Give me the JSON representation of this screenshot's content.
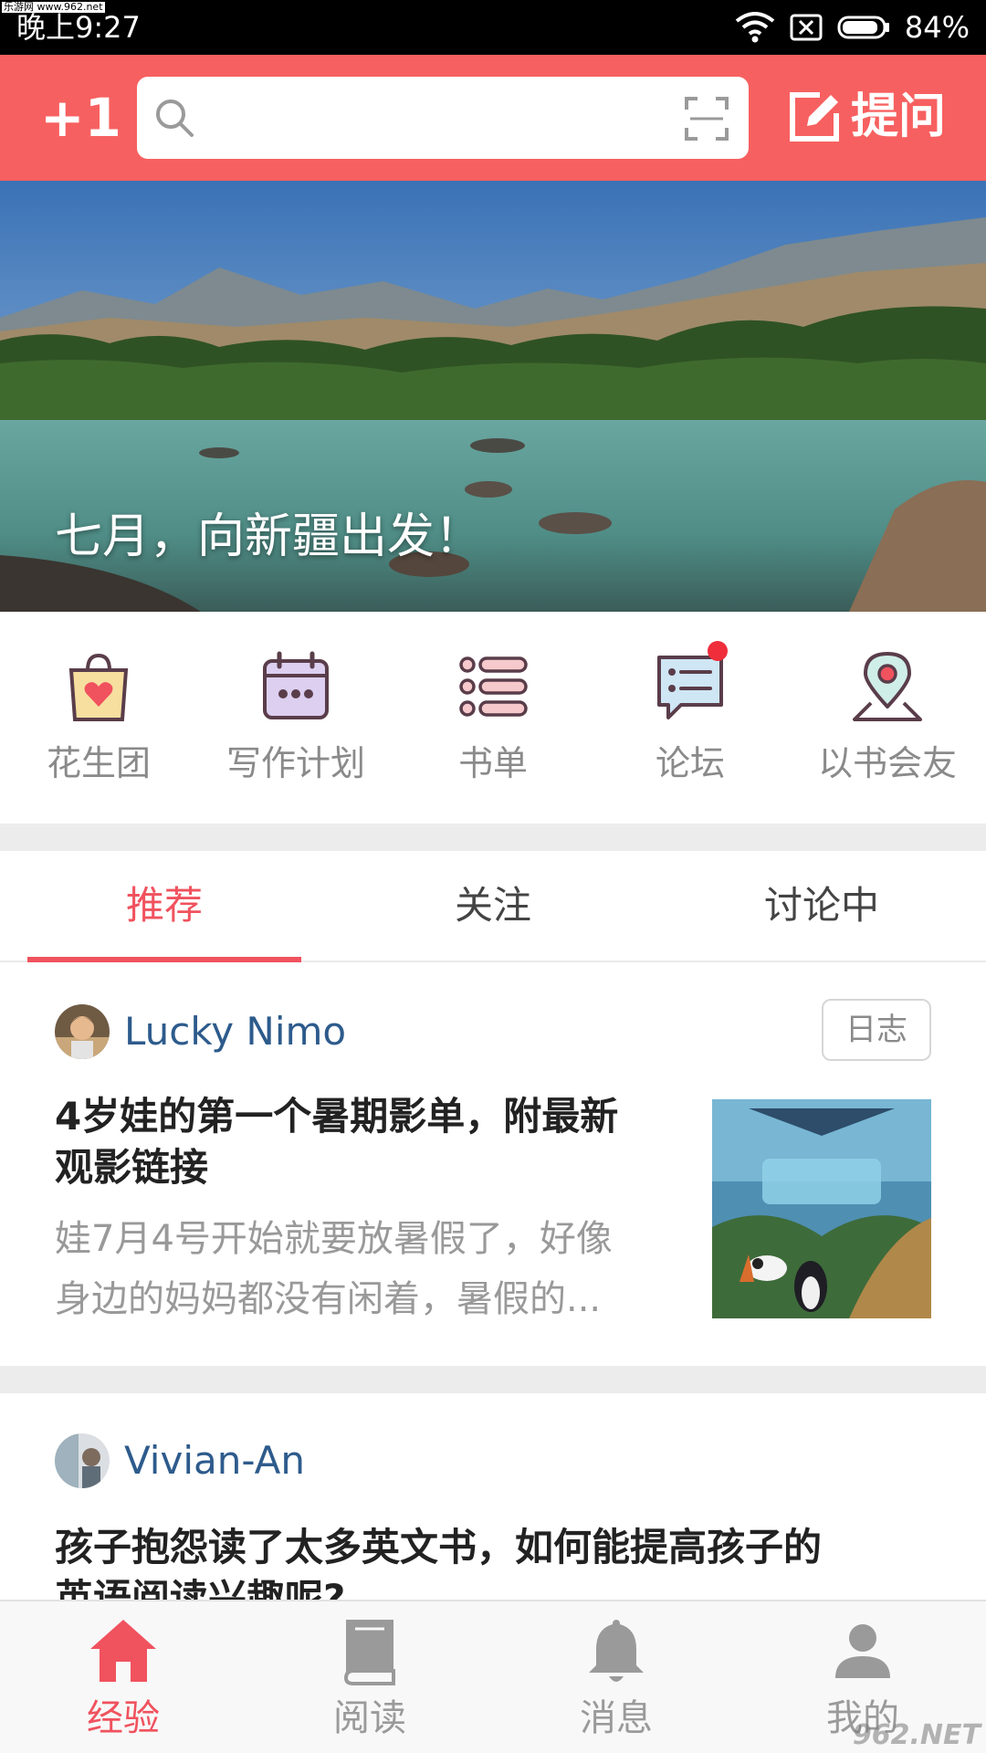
{
  "status_bar": {
    "watermark": "乐游网 www.962.net",
    "time": "晚上9:27",
    "battery": "84%",
    "icons": [
      "wifi-icon",
      "no-sim-icon",
      "battery-icon"
    ]
  },
  "header": {
    "plus_label": "+1",
    "search_placeholder": "",
    "ask_label": "提问",
    "accent_color": "#f76060"
  },
  "banner": {
    "caption": "七月，向新疆出发！"
  },
  "shortcuts": [
    {
      "label": "花生团",
      "icon": "gift-bag-icon"
    },
    {
      "label": "写作计划",
      "icon": "calendar-icon"
    },
    {
      "label": "书单",
      "icon": "list-icon"
    },
    {
      "label": "论坛",
      "icon": "chat-icon",
      "badge": "red-dot"
    },
    {
      "label": "以书会友",
      "icon": "location-pin-icon"
    }
  ],
  "tabs": [
    {
      "label": "推荐",
      "active": true
    },
    {
      "label": "关注",
      "active": false
    },
    {
      "label": "讨论中",
      "active": false
    }
  ],
  "feed": [
    {
      "author": "Lucky Nimo",
      "tag": "日志",
      "title_line1": "4岁娃的第一个暑期影单，附最新",
      "title_line2": "观影链接",
      "excerpt_line1": "娃7月4号开始就要放暑假了，好像",
      "excerpt_line2": "身边的妈妈都没有闲着，暑假的..."
    },
    {
      "author": "Vivian-An",
      "title_line1": "孩子抱怨读了太多英文书，如何能提高孩子的",
      "title_line2": "英语阅读兴趣呢?"
    }
  ],
  "bottom_nav": [
    {
      "label": "经验",
      "icon": "home-icon",
      "active": true
    },
    {
      "label": "阅读",
      "icon": "book-icon",
      "active": false
    },
    {
      "label": "消息",
      "icon": "bell-icon",
      "active": false
    },
    {
      "label": "我的",
      "icon": "user-icon",
      "active": false
    }
  ],
  "corner_watermark": "962.NET",
  "colors": {
    "accent": "#f0525e",
    "header": "#f76060",
    "link": "#2d5b8c"
  }
}
